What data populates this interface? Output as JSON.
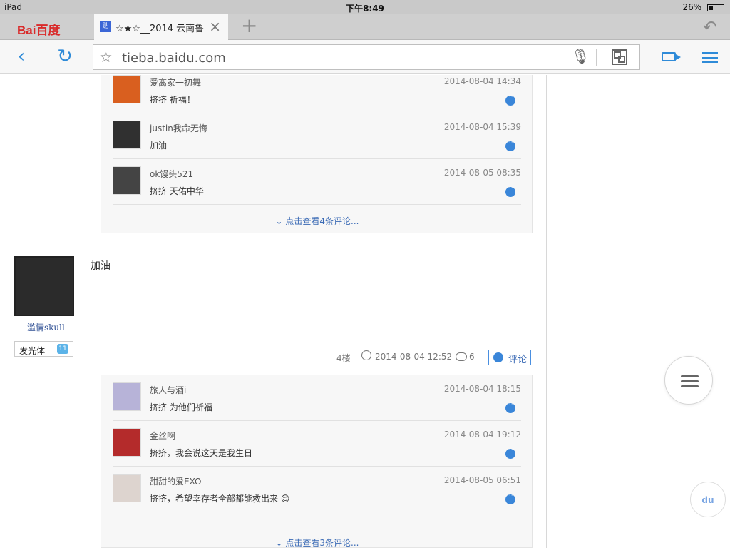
{
  "status": {
    "device": "iPad",
    "time": "下午8:49",
    "battery": "26%"
  },
  "browser": {
    "brand": "Bai百度",
    "active_tab_title": "☆★☆__2014 云南鲁",
    "url": "tieba.baidu.com",
    "accent_color": "#2f8bd8"
  },
  "comments_top": {
    "items": [
      {
        "name": "爱离家一初舞",
        "time": "2014-08-04 14:34",
        "text": "挤挤 祈福！"
      },
      {
        "name": "justin我命无悔",
        "time": "2014-08-04 15:39",
        "text": "加油"
      },
      {
        "name": "ok馒头521",
        "time": "2014-08-05 08:35",
        "text": "挤挤 天佑中华"
      }
    ],
    "more": "点击查看4条评论..."
  },
  "post": {
    "author": "滥情skull",
    "badge": "发光体",
    "level": "11",
    "content": "加油",
    "floor": "4楼",
    "datetime": "2014-08-04 12:52",
    "reply_count": "6",
    "comment_button": "评论"
  },
  "comments_bottom": {
    "items": [
      {
        "name": "旅人与酒i",
        "time": "2014-08-04 18:15",
        "text": "挤挤 为他们祈福"
      },
      {
        "name": "金丝啊",
        "time": "2014-08-04 19:12",
        "text": "挤挤，我会说这天是我生日"
      },
      {
        "name": "甜甜的爱EXO",
        "time": "2014-08-05 06:51",
        "text": "挤挤，希望幸存者全部都能救出来"
      }
    ],
    "more": "点击查看3条评论..."
  },
  "floating": {
    "menu_icon": "menu-icon",
    "baidu_icon": "du"
  }
}
